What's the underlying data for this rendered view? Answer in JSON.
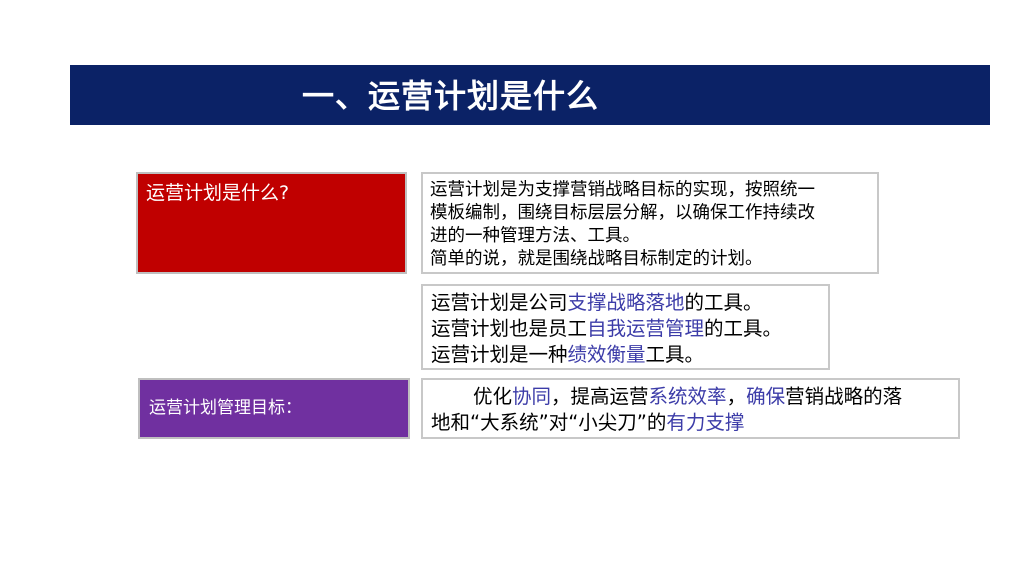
{
  "header": {
    "title": "一、运营计划是什么"
  },
  "definition": {
    "label": "运营计划是什么?",
    "lines": [
      "运营计划是为支撑营销战略目标的实现，按照统一",
      "模板编制，围绕目标层层分解，以确保工作持续改",
      "进的一种管理方法、工具。",
      "简单的说，就是围绕战略目标制定的计划。"
    ]
  },
  "roles": {
    "line1": {
      "pre": "运营计划是公司",
      "hl": "支撑战略落地",
      "post": "的工具。"
    },
    "line2": {
      "pre": "运营计划也是员工",
      "hl": "自我运营管理",
      "post": "的工具。"
    },
    "line3": {
      "pre": "运营计划是一种",
      "hl": "绩效衡量",
      "post": "工具。"
    }
  },
  "goal": {
    "label": "运营计划管理目标：",
    "l1_a": "优化",
    "l1_b": "协同",
    "l1_c": "，提高运营",
    "l1_d": "系统效率",
    "l1_e": "，",
    "l1_f": "确保",
    "l1_g": "营销战略的落",
    "l2_a": "地和“大系统”对“小尖刀”的",
    "l2_b": "有力支撑"
  },
  "colors": {
    "banner": "#0b2266",
    "label_red": "#c00000",
    "label_purple": "#7030a0",
    "highlight": "#3c3ca8"
  }
}
